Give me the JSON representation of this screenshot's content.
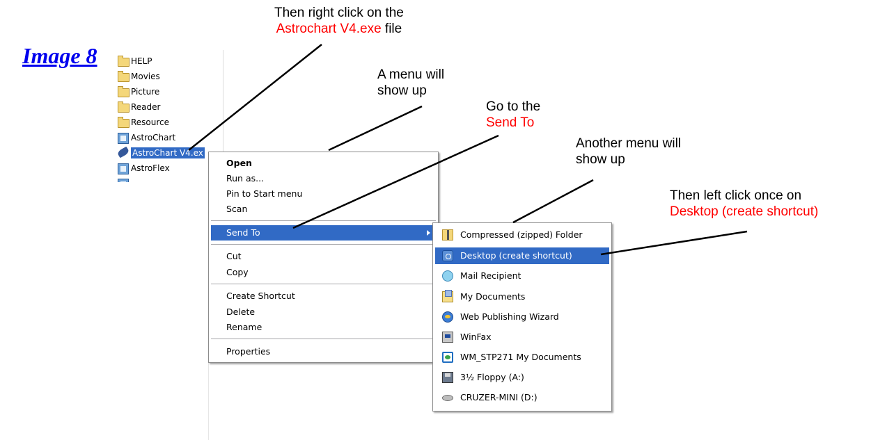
{
  "image_label": "Image 8",
  "annotations": {
    "step1": {
      "line1": "Then right click on the",
      "red": "Astrochart V4.exe",
      "tail": " file"
    },
    "step2": {
      "line1": "A menu will",
      "line2": "show up"
    },
    "step3": {
      "line1": "Go to the",
      "red": "Send To"
    },
    "step4": {
      "line1": "Another menu will",
      "line2": "show up"
    },
    "step5": {
      "line1": "Then left click once on",
      "red": "Desktop (create shortcut)"
    }
  },
  "explorer": {
    "items": [
      {
        "icon": "folder-icon",
        "label": "HELP"
      },
      {
        "icon": "folder-icon",
        "label": "Movies"
      },
      {
        "icon": "folder-icon",
        "label": "Picture"
      },
      {
        "icon": "folder-icon",
        "label": "Reader"
      },
      {
        "icon": "folder-icon",
        "label": "Resource"
      },
      {
        "icon": "shortcut-icon",
        "label": "AstroChart"
      },
      {
        "icon": "feather-icon",
        "label": "AstroChart V4.ex",
        "selected": true
      },
      {
        "icon": "shortcut-icon",
        "label": "AstroFlex"
      }
    ]
  },
  "context_menu": {
    "items": [
      "Open",
      "Run as...",
      "Pin to Start menu",
      "Scan",
      "Send To",
      "Cut",
      "Copy",
      "Create Shortcut",
      "Delete",
      "Rename",
      "Properties"
    ]
  },
  "send_to_menu": {
    "items": [
      {
        "icon": "zip-folder-icon",
        "label": "Compressed (zipped) Folder"
      },
      {
        "icon": "desktop-icon",
        "label": "Desktop (create shortcut)",
        "highlighted": true
      },
      {
        "icon": "mail-icon",
        "label": "Mail Recipient"
      },
      {
        "icon": "my-documents-icon",
        "label": "My Documents"
      },
      {
        "icon": "web-publishing-icon",
        "label": "Web Publishing Wizard"
      },
      {
        "icon": "winfax-icon",
        "label": "WinFax"
      },
      {
        "icon": "wm-folder-icon",
        "label": "WM_STP271 My Documents"
      },
      {
        "icon": "floppy-icon",
        "label": "3½ Floppy (A:)"
      },
      {
        "icon": "drive-icon",
        "label": "CRUZER-MINI (D:)"
      }
    ]
  },
  "colors": {
    "highlight": "#316ac5",
    "annotation_red": "#ff0000",
    "link_blue": "#0000ee"
  }
}
